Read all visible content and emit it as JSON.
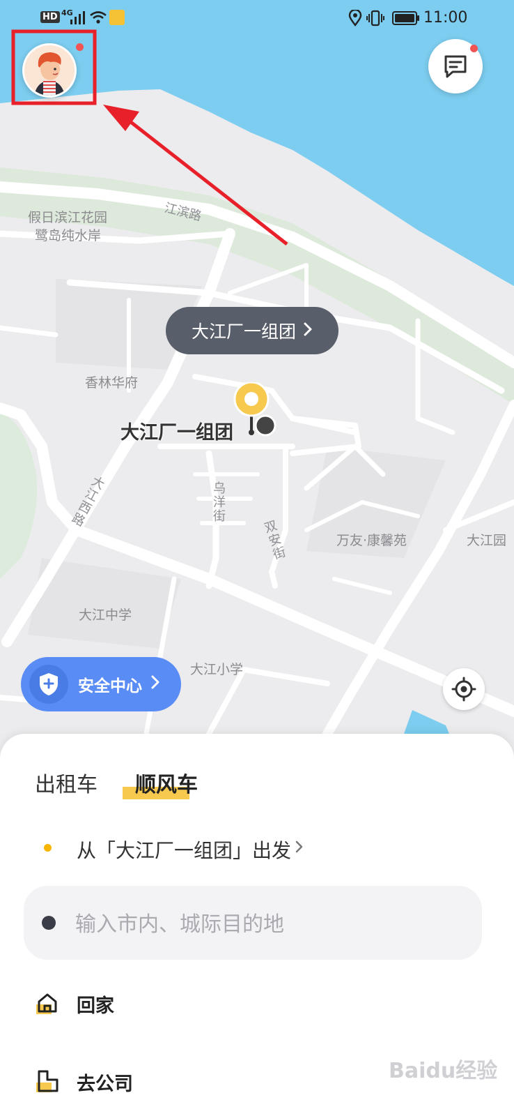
{
  "status_bar": {
    "time": "11:00",
    "hd": "HD",
    "network": "4G"
  },
  "map": {
    "pill_label": "大江厂一组团",
    "marker_label": "大江厂一组团",
    "places": [
      {
        "text": "假日滨江花园"
      },
      {
        "text": "鹭岛纯水岸"
      },
      {
        "text": "江滨路"
      },
      {
        "text": "香林华府"
      },
      {
        "text": "大江西路"
      },
      {
        "text": "乌洋街"
      },
      {
        "text": "双安街"
      },
      {
        "text": "万友·康馨苑"
      },
      {
        "text": "大江园"
      },
      {
        "text": "大江中学"
      },
      {
        "text": "大江小学"
      }
    ],
    "safety_label": "安全中心",
    "colors": {
      "water": "#7ccdf0",
      "park": "#dde9da",
      "road": "#ffffff",
      "land": "#ececee"
    }
  },
  "panel": {
    "tabs": [
      "出租车",
      "顺风车"
    ],
    "active_tab": 1,
    "origin_text": "从「大江厂一组团」出发",
    "destination_placeholder": "输入市内、城际目的地",
    "shortcuts": [
      "回家",
      "去公司"
    ]
  },
  "watermark": "Baidu经验",
  "accent_color": "#f7c94f",
  "annotation_color": "#e8202a"
}
